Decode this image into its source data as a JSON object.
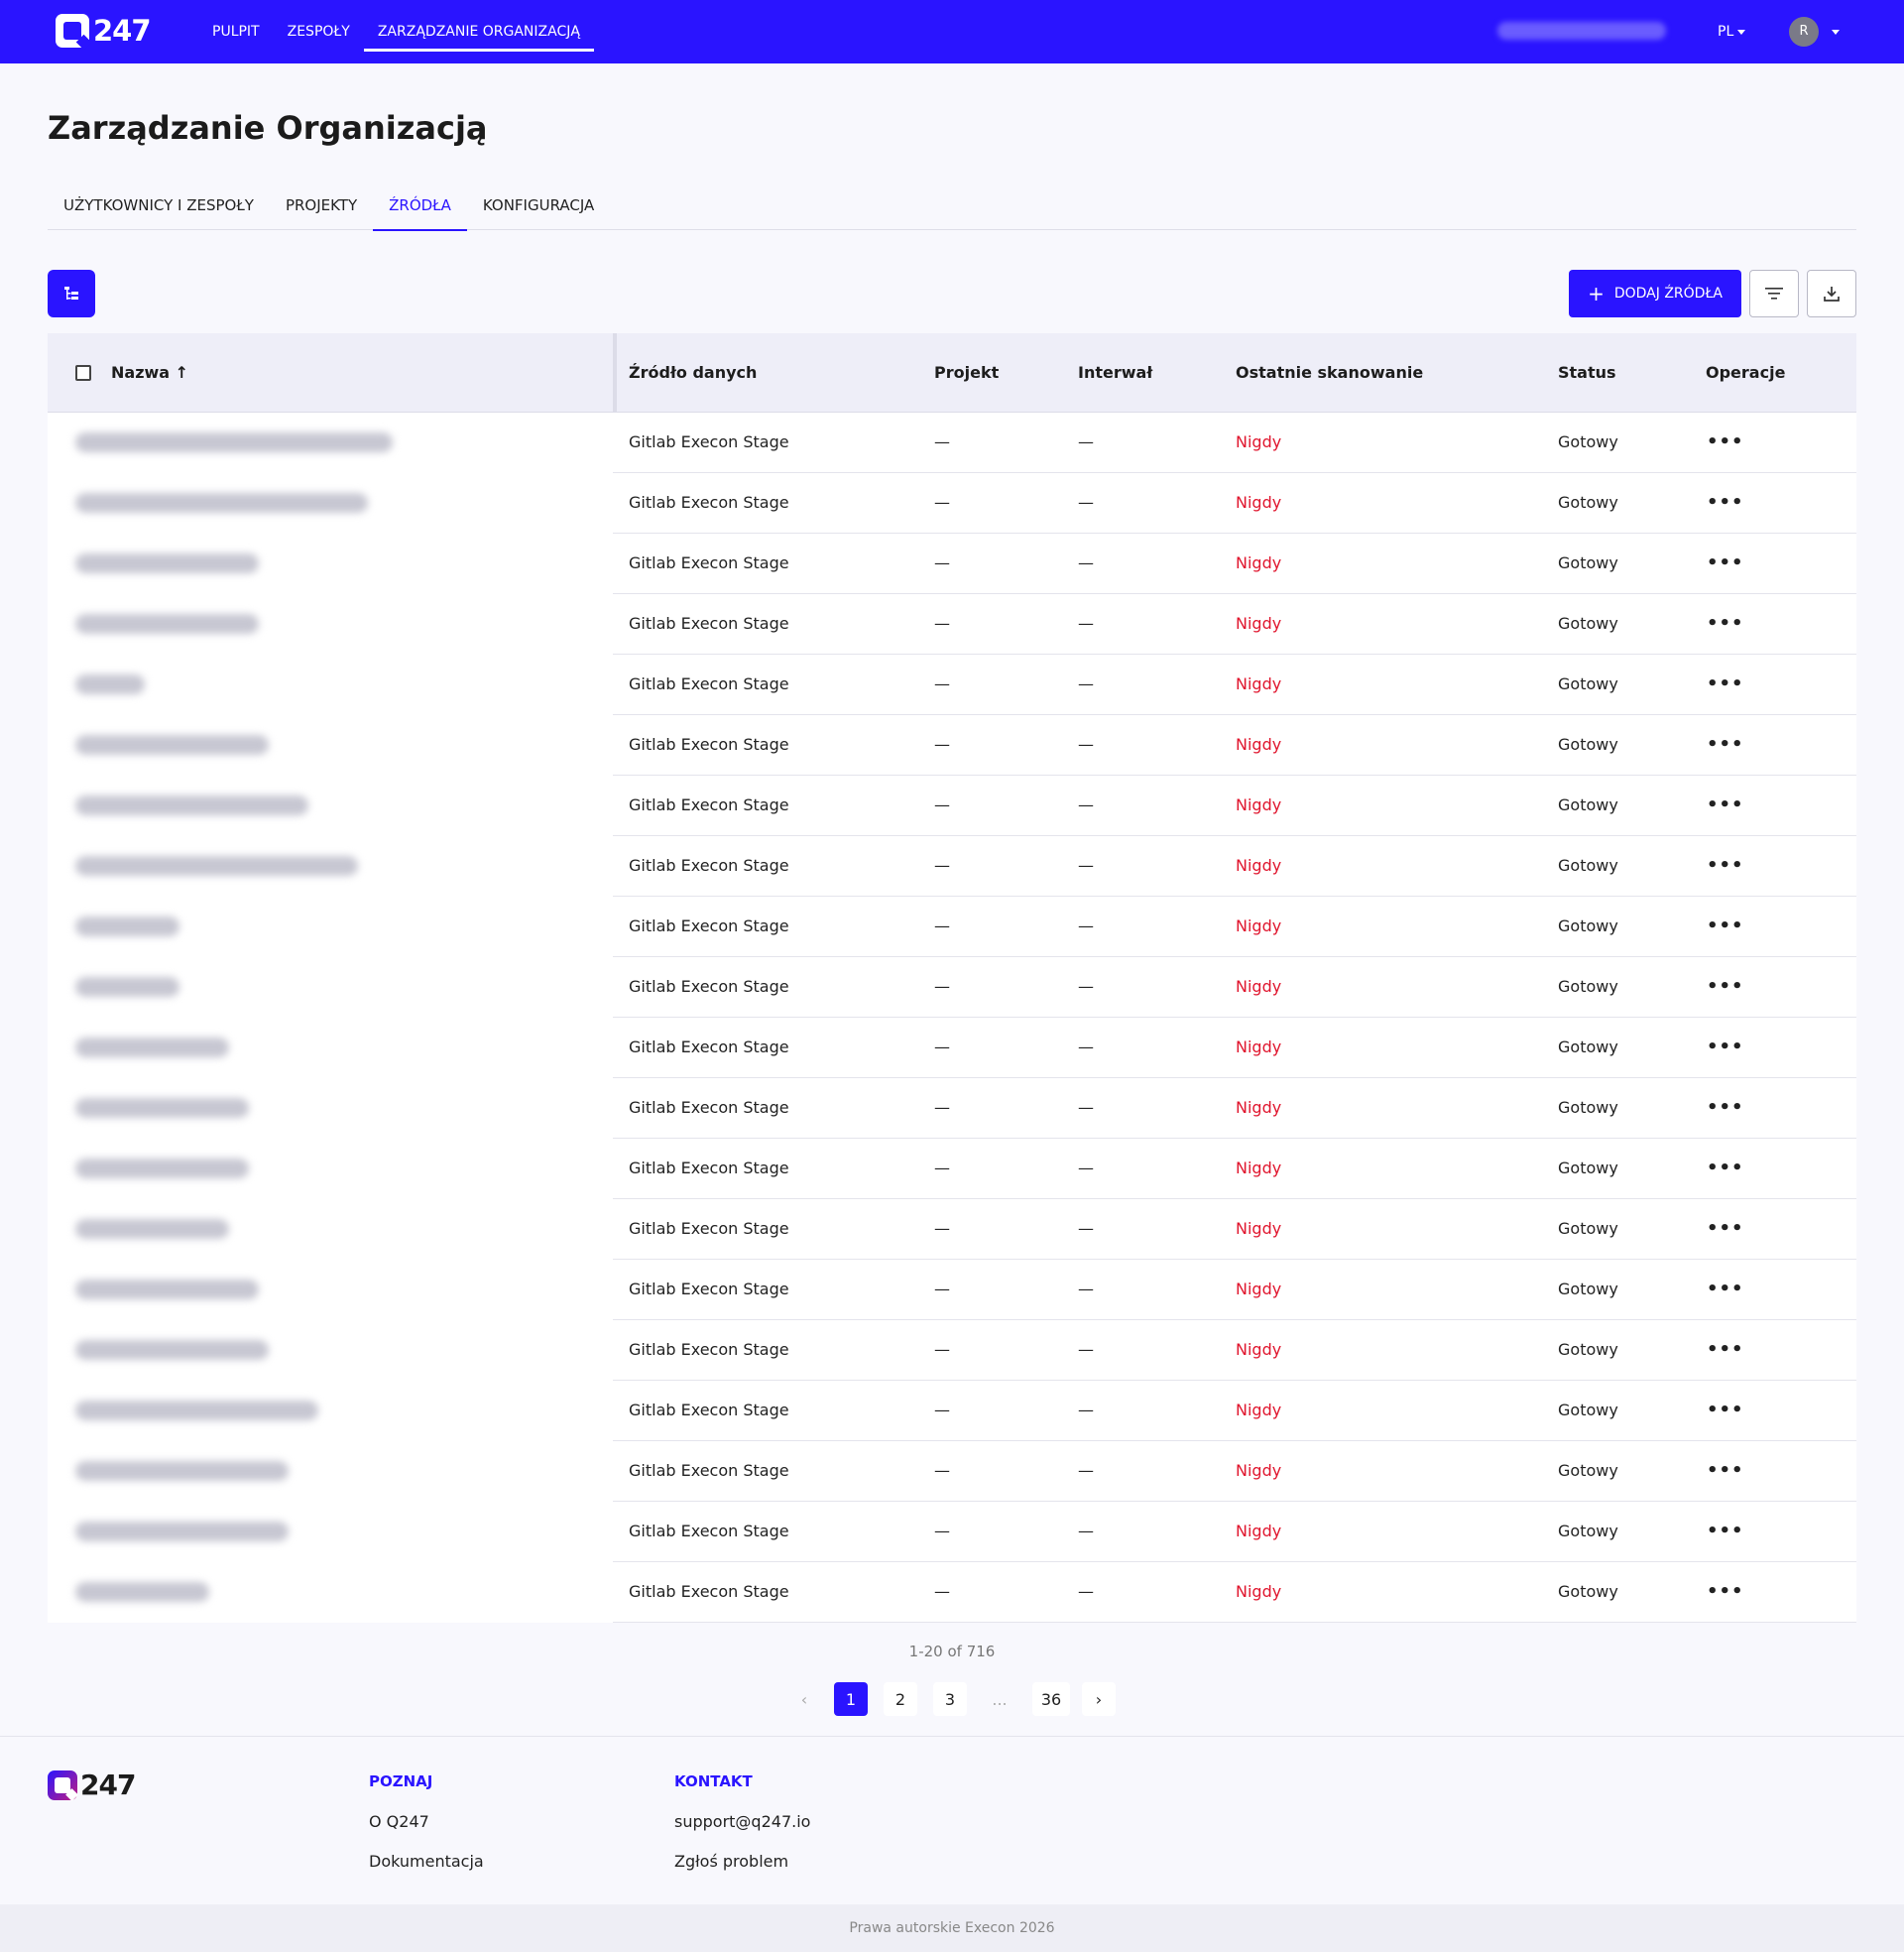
{
  "header": {
    "logo_text": "247",
    "nav": [
      "PULPIT",
      "ZESPOŁY",
      "ZARZĄDZANIE ORGANIZACJĄ"
    ],
    "lang": "PL",
    "avatar_initial": "R"
  },
  "page": {
    "title": "Zarządzanie Organizacją",
    "tabs": [
      "UŻYTKOWNICY I ZESPOŁY",
      "PROJEKTY",
      "ŹRÓDŁA",
      "KONFIGURACJA"
    ],
    "active_tab": "ŹRÓDŁA"
  },
  "toolbar": {
    "add_label": "DODAJ ŹRÓDŁA"
  },
  "table": {
    "headers": {
      "name": "Nazwa",
      "source": "Źródło danych",
      "project": "Projekt",
      "interval": "Interwał",
      "last_scan": "Ostatnie skanowanie",
      "status": "Status",
      "ops": "Operacje"
    },
    "sort_arrow": "↑",
    "rows": [
      {
        "source": "Gitlab Execon Stage",
        "project": "—",
        "interval": "—",
        "last_scan": "Nigdy",
        "status": "Gotowy",
        "ops": "•••"
      },
      {
        "source": "Gitlab Execon Stage",
        "project": "—",
        "interval": "—",
        "last_scan": "Nigdy",
        "status": "Gotowy",
        "ops": "•••"
      },
      {
        "source": "Gitlab Execon Stage",
        "project": "—",
        "interval": "—",
        "last_scan": "Nigdy",
        "status": "Gotowy",
        "ops": "•••"
      },
      {
        "source": "Gitlab Execon Stage",
        "project": "—",
        "interval": "—",
        "last_scan": "Nigdy",
        "status": "Gotowy",
        "ops": "•••"
      },
      {
        "source": "Gitlab Execon Stage",
        "project": "—",
        "interval": "—",
        "last_scan": "Nigdy",
        "status": "Gotowy",
        "ops": "•••"
      },
      {
        "source": "Gitlab Execon Stage",
        "project": "—",
        "interval": "—",
        "last_scan": "Nigdy",
        "status": "Gotowy",
        "ops": "•••"
      },
      {
        "source": "Gitlab Execon Stage",
        "project": "—",
        "interval": "—",
        "last_scan": "Nigdy",
        "status": "Gotowy",
        "ops": "•••"
      },
      {
        "source": "Gitlab Execon Stage",
        "project": "—",
        "interval": "—",
        "last_scan": "Nigdy",
        "status": "Gotowy",
        "ops": "•••"
      },
      {
        "source": "Gitlab Execon Stage",
        "project": "—",
        "interval": "—",
        "last_scan": "Nigdy",
        "status": "Gotowy",
        "ops": "•••"
      },
      {
        "source": "Gitlab Execon Stage",
        "project": "—",
        "interval": "—",
        "last_scan": "Nigdy",
        "status": "Gotowy",
        "ops": "•••"
      },
      {
        "source": "Gitlab Execon Stage",
        "project": "—",
        "interval": "—",
        "last_scan": "Nigdy",
        "status": "Gotowy",
        "ops": "•••"
      },
      {
        "source": "Gitlab Execon Stage",
        "project": "—",
        "interval": "—",
        "last_scan": "Nigdy",
        "status": "Gotowy",
        "ops": "•••"
      },
      {
        "source": "Gitlab Execon Stage",
        "project": "—",
        "interval": "—",
        "last_scan": "Nigdy",
        "status": "Gotowy",
        "ops": "•••"
      },
      {
        "source": "Gitlab Execon Stage",
        "project": "—",
        "interval": "—",
        "last_scan": "Nigdy",
        "status": "Gotowy",
        "ops": "•••"
      },
      {
        "source": "Gitlab Execon Stage",
        "project": "—",
        "interval": "—",
        "last_scan": "Nigdy",
        "status": "Gotowy",
        "ops": "•••"
      },
      {
        "source": "Gitlab Execon Stage",
        "project": "—",
        "interval": "—",
        "last_scan": "Nigdy",
        "status": "Gotowy",
        "ops": "•••"
      },
      {
        "source": "Gitlab Execon Stage",
        "project": "—",
        "interval": "—",
        "last_scan": "Nigdy",
        "status": "Gotowy",
        "ops": "•••"
      },
      {
        "source": "Gitlab Execon Stage",
        "project": "—",
        "interval": "—",
        "last_scan": "Nigdy",
        "status": "Gotowy",
        "ops": "•••"
      },
      {
        "source": "Gitlab Execon Stage",
        "project": "—",
        "interval": "—",
        "last_scan": "Nigdy",
        "status": "Gotowy",
        "ops": "•••"
      },
      {
        "source": "Gitlab Execon Stage",
        "project": "—",
        "interval": "—",
        "last_scan": "Nigdy",
        "status": "Gotowy",
        "ops": "•••"
      }
    ]
  },
  "pagination": {
    "info": "1-20 of 716",
    "prev": "‹",
    "pages": [
      "1",
      "2",
      "3",
      "...",
      "36"
    ],
    "next": "›"
  },
  "footer": {
    "logo_text": "247",
    "col1_title": "POZNAJ",
    "col1_links": [
      "O Q247",
      "Dokumentacja"
    ],
    "col2_title": "KONTAKT",
    "col2_links": [
      "support@q247.io",
      "Zgłoś problem"
    ],
    "copyright": "Prawa autorskie Execon 2026"
  },
  "colors": {
    "brand": "#2a14ff",
    "danger": "#e0152d"
  }
}
